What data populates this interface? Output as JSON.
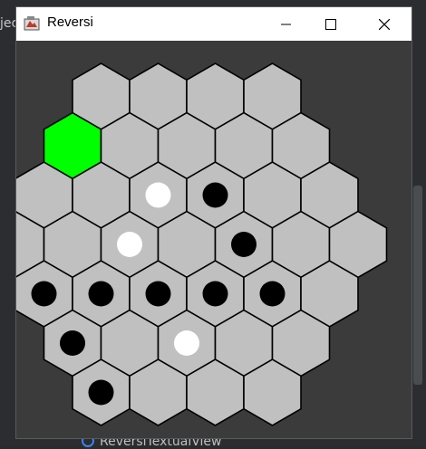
{
  "window": {
    "title": "Reversi"
  },
  "background": {
    "ide_text": "jec",
    "bottom_label": "ReversiTextualView"
  },
  "icons": {
    "app": "reversi-app-icon",
    "minimize": "minimize-icon",
    "maximize": "maximize-icon",
    "close": "close-icon"
  },
  "colors": {
    "cell": "#c0c0c0",
    "selected": "#00ff00",
    "board_bg": "#3b3b3b"
  },
  "board": {
    "rows": [
      {
        "r": -3,
        "q_start": 0,
        "cells": [
          "empty",
          "empty",
          "empty",
          "empty"
        ]
      },
      {
        "r": -2,
        "q_start": -1,
        "cells": [
          "selected",
          "empty",
          "empty",
          "empty",
          "empty"
        ]
      },
      {
        "r": -1,
        "q_start": -2,
        "cells": [
          "empty",
          "empty",
          "white",
          "black",
          "empty",
          "empty"
        ]
      },
      {
        "r": 0,
        "q_start": -3,
        "cells": [
          "empty",
          "empty",
          "white",
          "empty",
          "black",
          "empty",
          "empty"
        ]
      },
      {
        "r": 1,
        "q_start": -3,
        "cells": [
          "black",
          "black",
          "black",
          "black",
          "black",
          "empty"
        ]
      },
      {
        "r": 2,
        "q_start": -3,
        "cells": [
          "black",
          "empty",
          "white",
          "empty",
          "empty"
        ]
      },
      {
        "r": 3,
        "q_start": -3,
        "cells": [
          "black",
          "empty",
          "empty",
          "empty"
        ]
      }
    ]
  }
}
